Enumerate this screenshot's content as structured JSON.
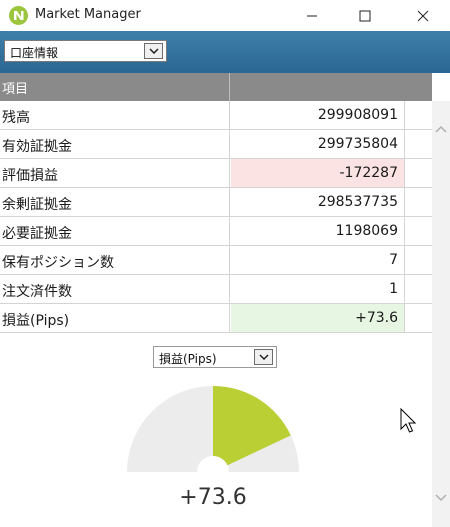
{
  "window": {
    "title": "Market Manager"
  },
  "toolbar": {
    "account_select_value": "口座情報"
  },
  "table": {
    "header": "項目",
    "rows": [
      {
        "label": "残高",
        "value": "299908091",
        "status": "normal"
      },
      {
        "label": "有効証拠金",
        "value": "299735804",
        "status": "normal"
      },
      {
        "label": "評価損益",
        "value": "-172287",
        "status": "negative"
      },
      {
        "label": "余剰証拠金",
        "value": "298537735",
        "status": "normal"
      },
      {
        "label": "必要証拠金",
        "value": "1198069",
        "status": "normal"
      },
      {
        "label": "保有ポジション数",
        "value": "7",
        "status": "normal"
      },
      {
        "label": "注文済件数",
        "value": "1",
        "status": "normal"
      },
      {
        "label": "損益(Pips)",
        "value": "+73.6",
        "status": "positive"
      }
    ]
  },
  "gauge": {
    "select_value": "損益(Pips)",
    "value_text": "+73.6",
    "fill_fraction": 0.36,
    "fill_color": "#b9cf34",
    "track_color": "#ececec"
  },
  "colors": {
    "toolbar": "#2f6d98",
    "header": "#8a8a8a",
    "negative_cell": "#fbe3e3",
    "positive_cell": "#e7f6e3"
  }
}
